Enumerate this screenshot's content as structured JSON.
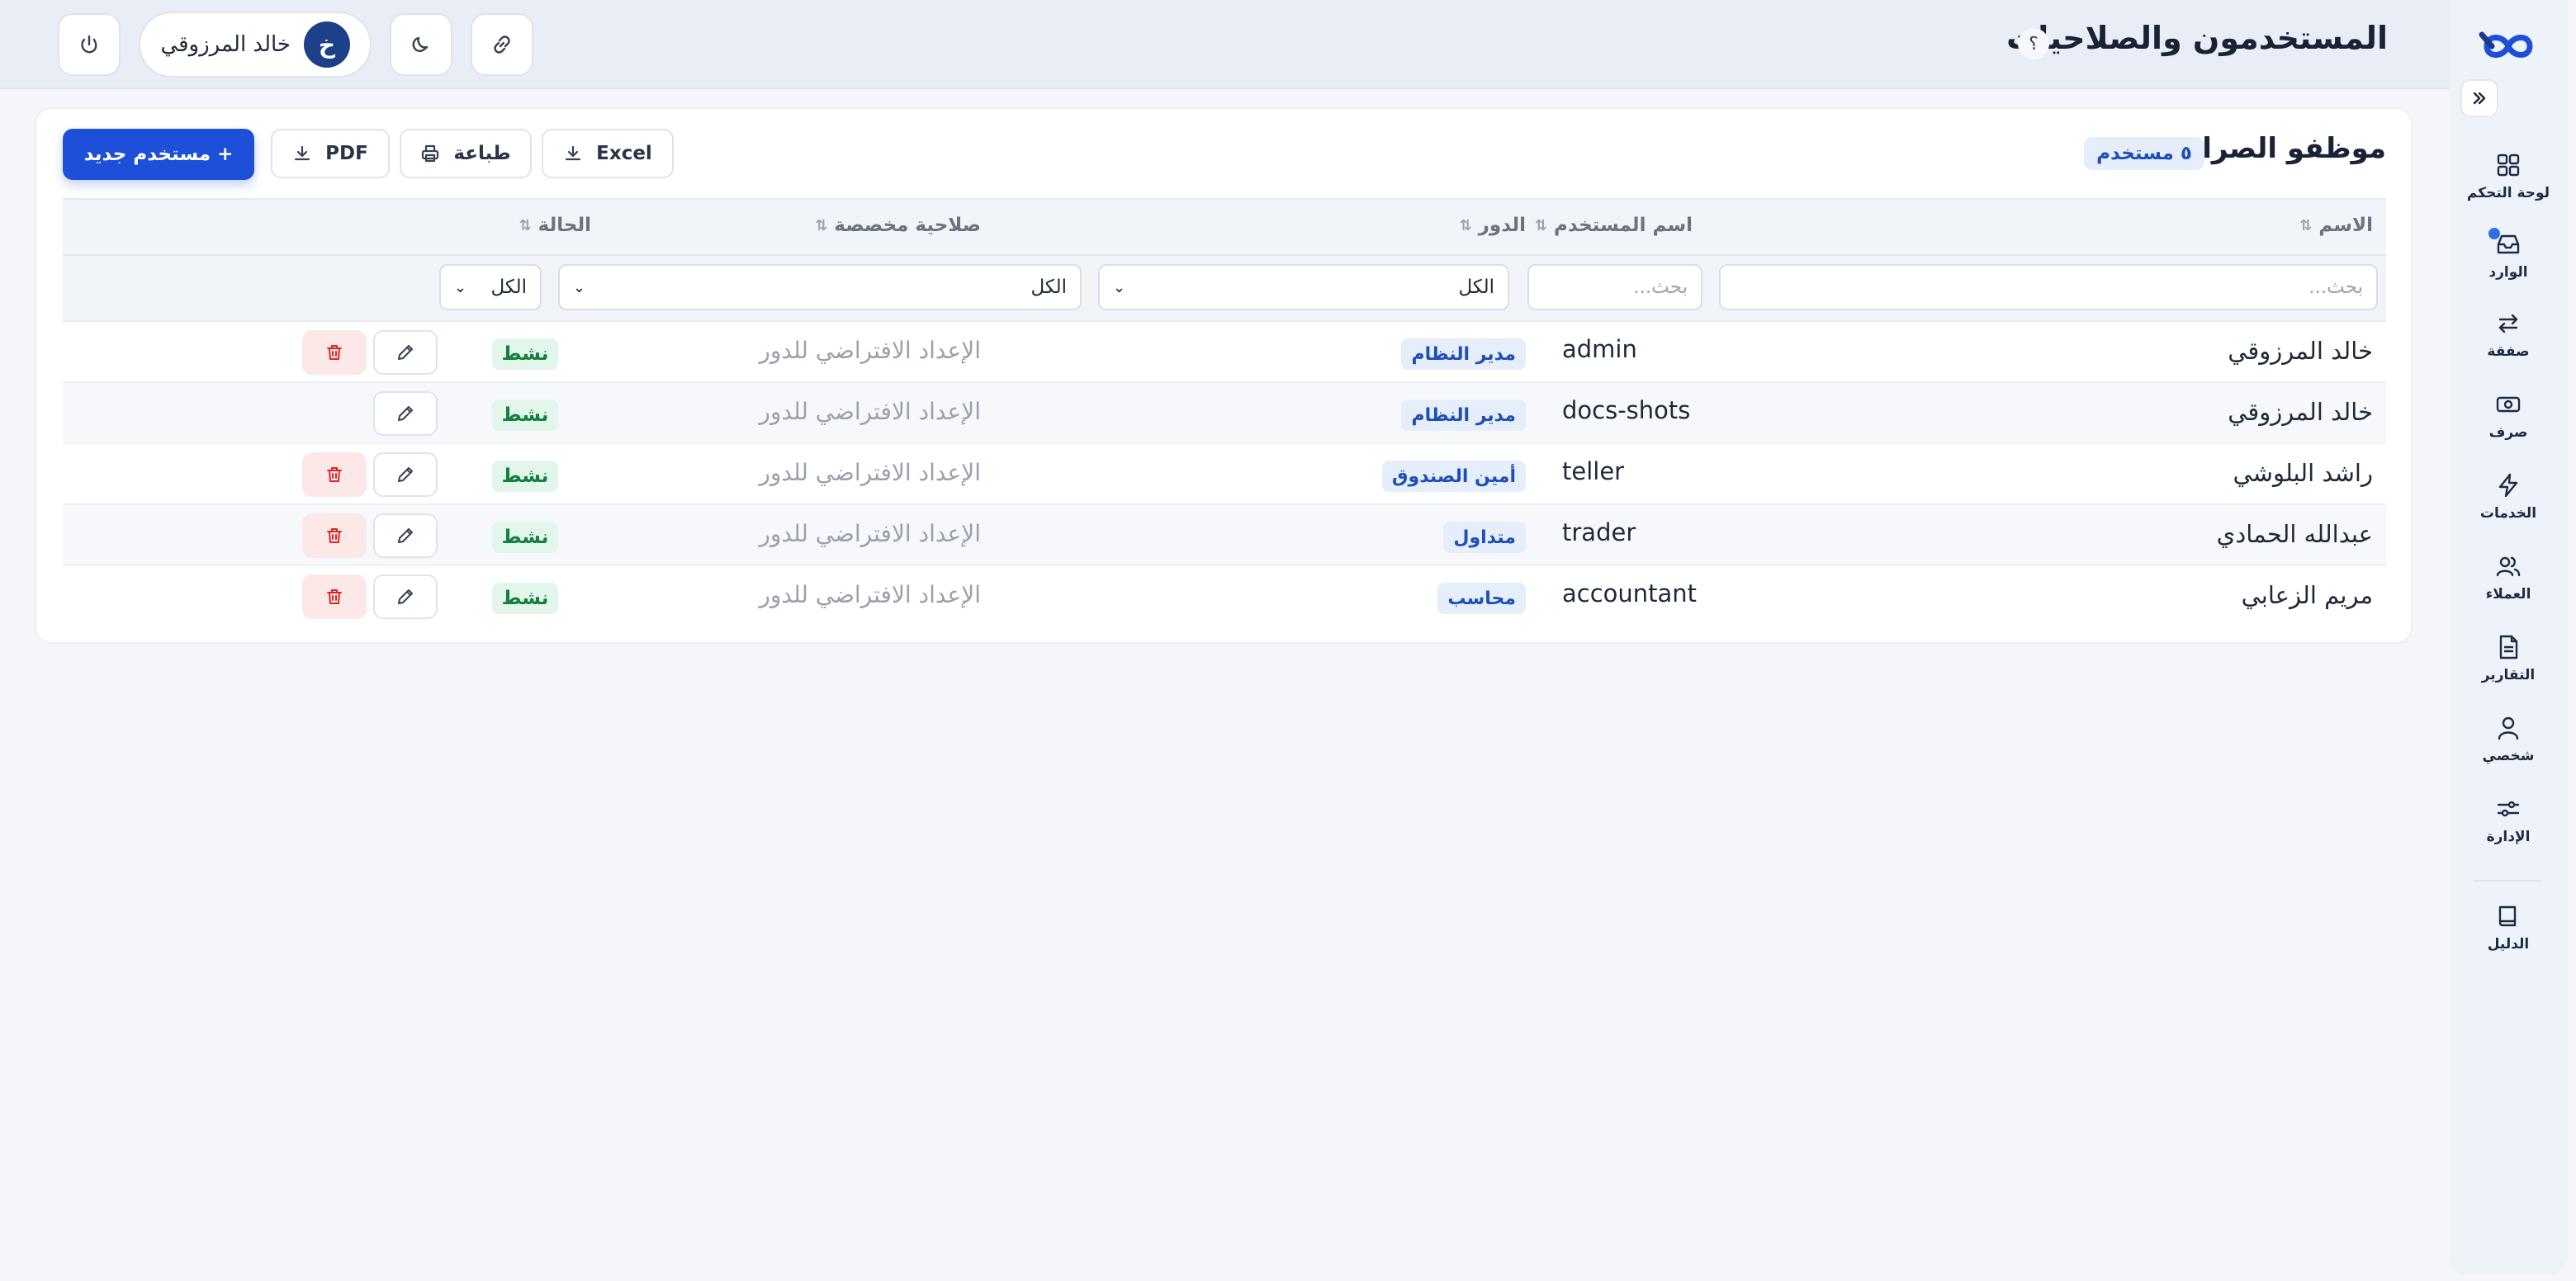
{
  "header": {
    "title": "المستخدمون والصلاحيات",
    "help_label": "؟",
    "user_name": "خالد المرزوقي",
    "avatar_initial": "خ"
  },
  "sidebar": {
    "items": [
      {
        "label": "لوحة التحكم",
        "icon": "dashboard-icon"
      },
      {
        "label": "الوارد",
        "icon": "inbox-icon"
      },
      {
        "label": "صفقة",
        "icon": "transfer-icon"
      },
      {
        "label": "صرف",
        "icon": "cash-icon"
      },
      {
        "label": "الخدمات",
        "icon": "bolt-icon"
      },
      {
        "label": "العملاء",
        "icon": "users-icon"
      },
      {
        "label": "التقارير",
        "icon": "report-icon"
      },
      {
        "label": "شخصي",
        "icon": "person-icon"
      },
      {
        "label": "الإدارة",
        "icon": "sliders-icon"
      },
      {
        "label": "الدليل",
        "icon": "book-icon"
      }
    ]
  },
  "card": {
    "title": "موظفو الصرافة",
    "count_badge": "٥ مستخدم",
    "excel_label": "Excel",
    "print_label": "طباعة",
    "pdf_label": "PDF",
    "new_user_label": "+ مستخدم جديد"
  },
  "table": {
    "columns": {
      "name": "الاسم",
      "username": "اسم المستخدم",
      "role": "الدور",
      "permission": "صلاحية مخصصة",
      "status": "الحالة"
    },
    "filters": {
      "name_placeholder": "بحث...",
      "username_placeholder": "بحث...",
      "role_value": "الكل",
      "permission_value": "الكل",
      "status_value": "الكل"
    },
    "rows": [
      {
        "name": "خالد المرزوقي",
        "username": "admin",
        "role": "مدير النظام",
        "permission": "الإعداد الافتراضي للدور",
        "status": "نشط"
      },
      {
        "name": "خالد المرزوقي",
        "username": "docs-shots",
        "role": "مدير النظام",
        "permission": "الإعداد الافتراضي للدور",
        "status": "نشط"
      },
      {
        "name": "راشد البلوشي",
        "username": "teller",
        "role": "أمين الصندوق",
        "permission": "الإعداد الافتراضي للدور",
        "status": "نشط"
      },
      {
        "name": "عبدالله الحمادي",
        "username": "trader",
        "role": "متداول",
        "permission": "الإعداد الافتراضي للدور",
        "status": "نشط"
      },
      {
        "name": "مريم الزعابي",
        "username": "accountant",
        "role": "محاسب",
        "permission": "الإعداد الافتراضي للدور",
        "status": "نشط"
      }
    ]
  },
  "colors": {
    "primary": "#1d4fd8",
    "badge_blue_bg": "#e6eefb",
    "status_green": "#15803d",
    "danger": "#dc2626"
  }
}
